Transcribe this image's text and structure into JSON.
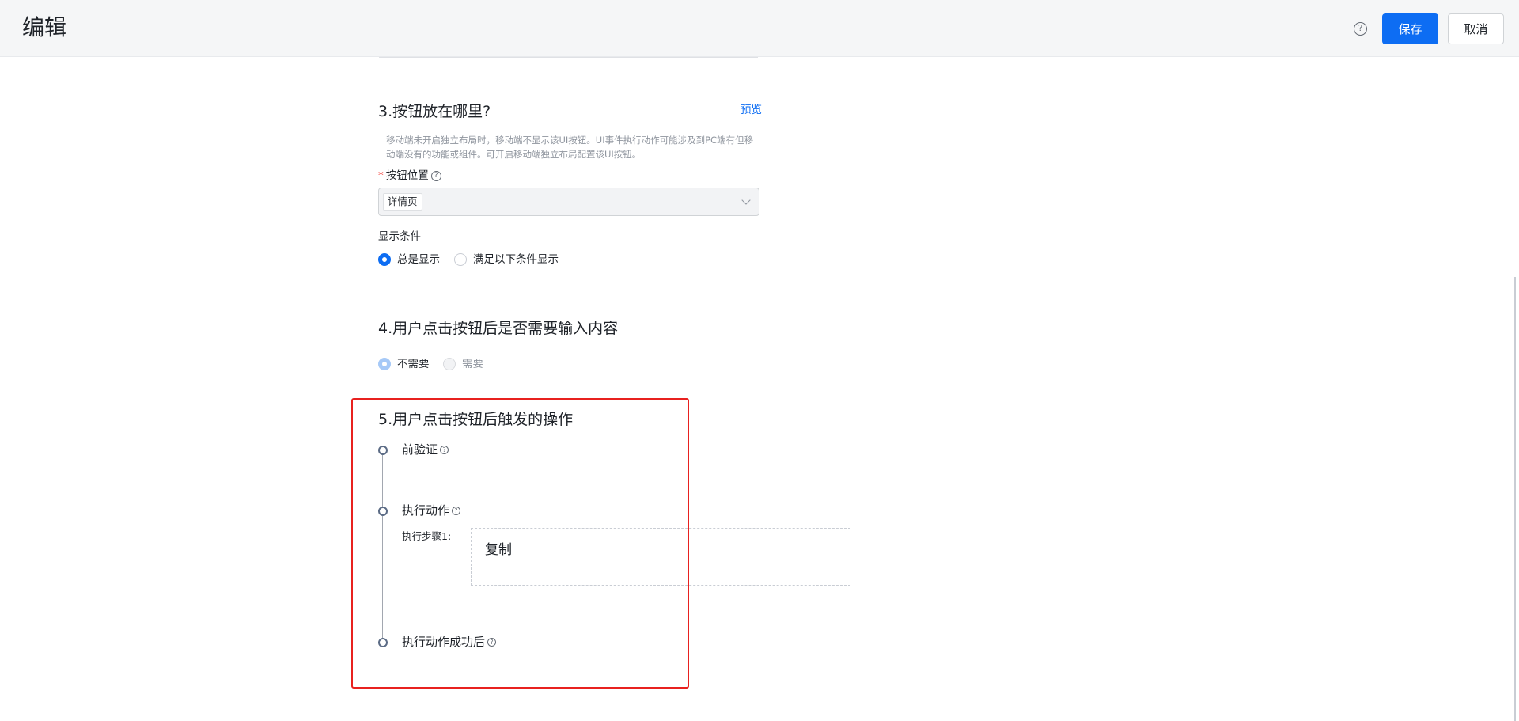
{
  "header": {
    "title": "编辑",
    "help_glyph": "?",
    "save_label": "保存",
    "cancel_label": "取消"
  },
  "section3": {
    "title": "3.按钮放在哪里?",
    "preview_link": "预览",
    "description": "移动端未开启独立布局时，移动端不显示该UI按钮。UI事件执行动作可能涉及到PC端有但移动端没有的功能或组件。可开启移动端独立布局配置该UI按钮。",
    "position_label": "按钮位置",
    "required_mark": "*",
    "position_selected": "详情页",
    "display_condition_label": "显示条件",
    "display_options": [
      {
        "label": "总是显示",
        "checked": true
      },
      {
        "label": "满足以下条件显示",
        "checked": false
      }
    ]
  },
  "section4": {
    "title": "4.用户点击按钮后是否需要输入内容",
    "options": [
      {
        "label": "不需要",
        "checked": true
      },
      {
        "label": "需要",
        "checked": false,
        "disabled": true
      }
    ]
  },
  "section5": {
    "title": "5.用户点击按钮后触发的操作",
    "steps": [
      {
        "title": "前验证"
      },
      {
        "title": "执行动作",
        "sub_label": "执行步骤1:",
        "action": "复制"
      },
      {
        "title": "执行动作成功后"
      }
    ]
  },
  "colors": {
    "primary": "#0d6df3",
    "highlight_border": "#e8211f",
    "header_bg": "#f5f6f7"
  }
}
